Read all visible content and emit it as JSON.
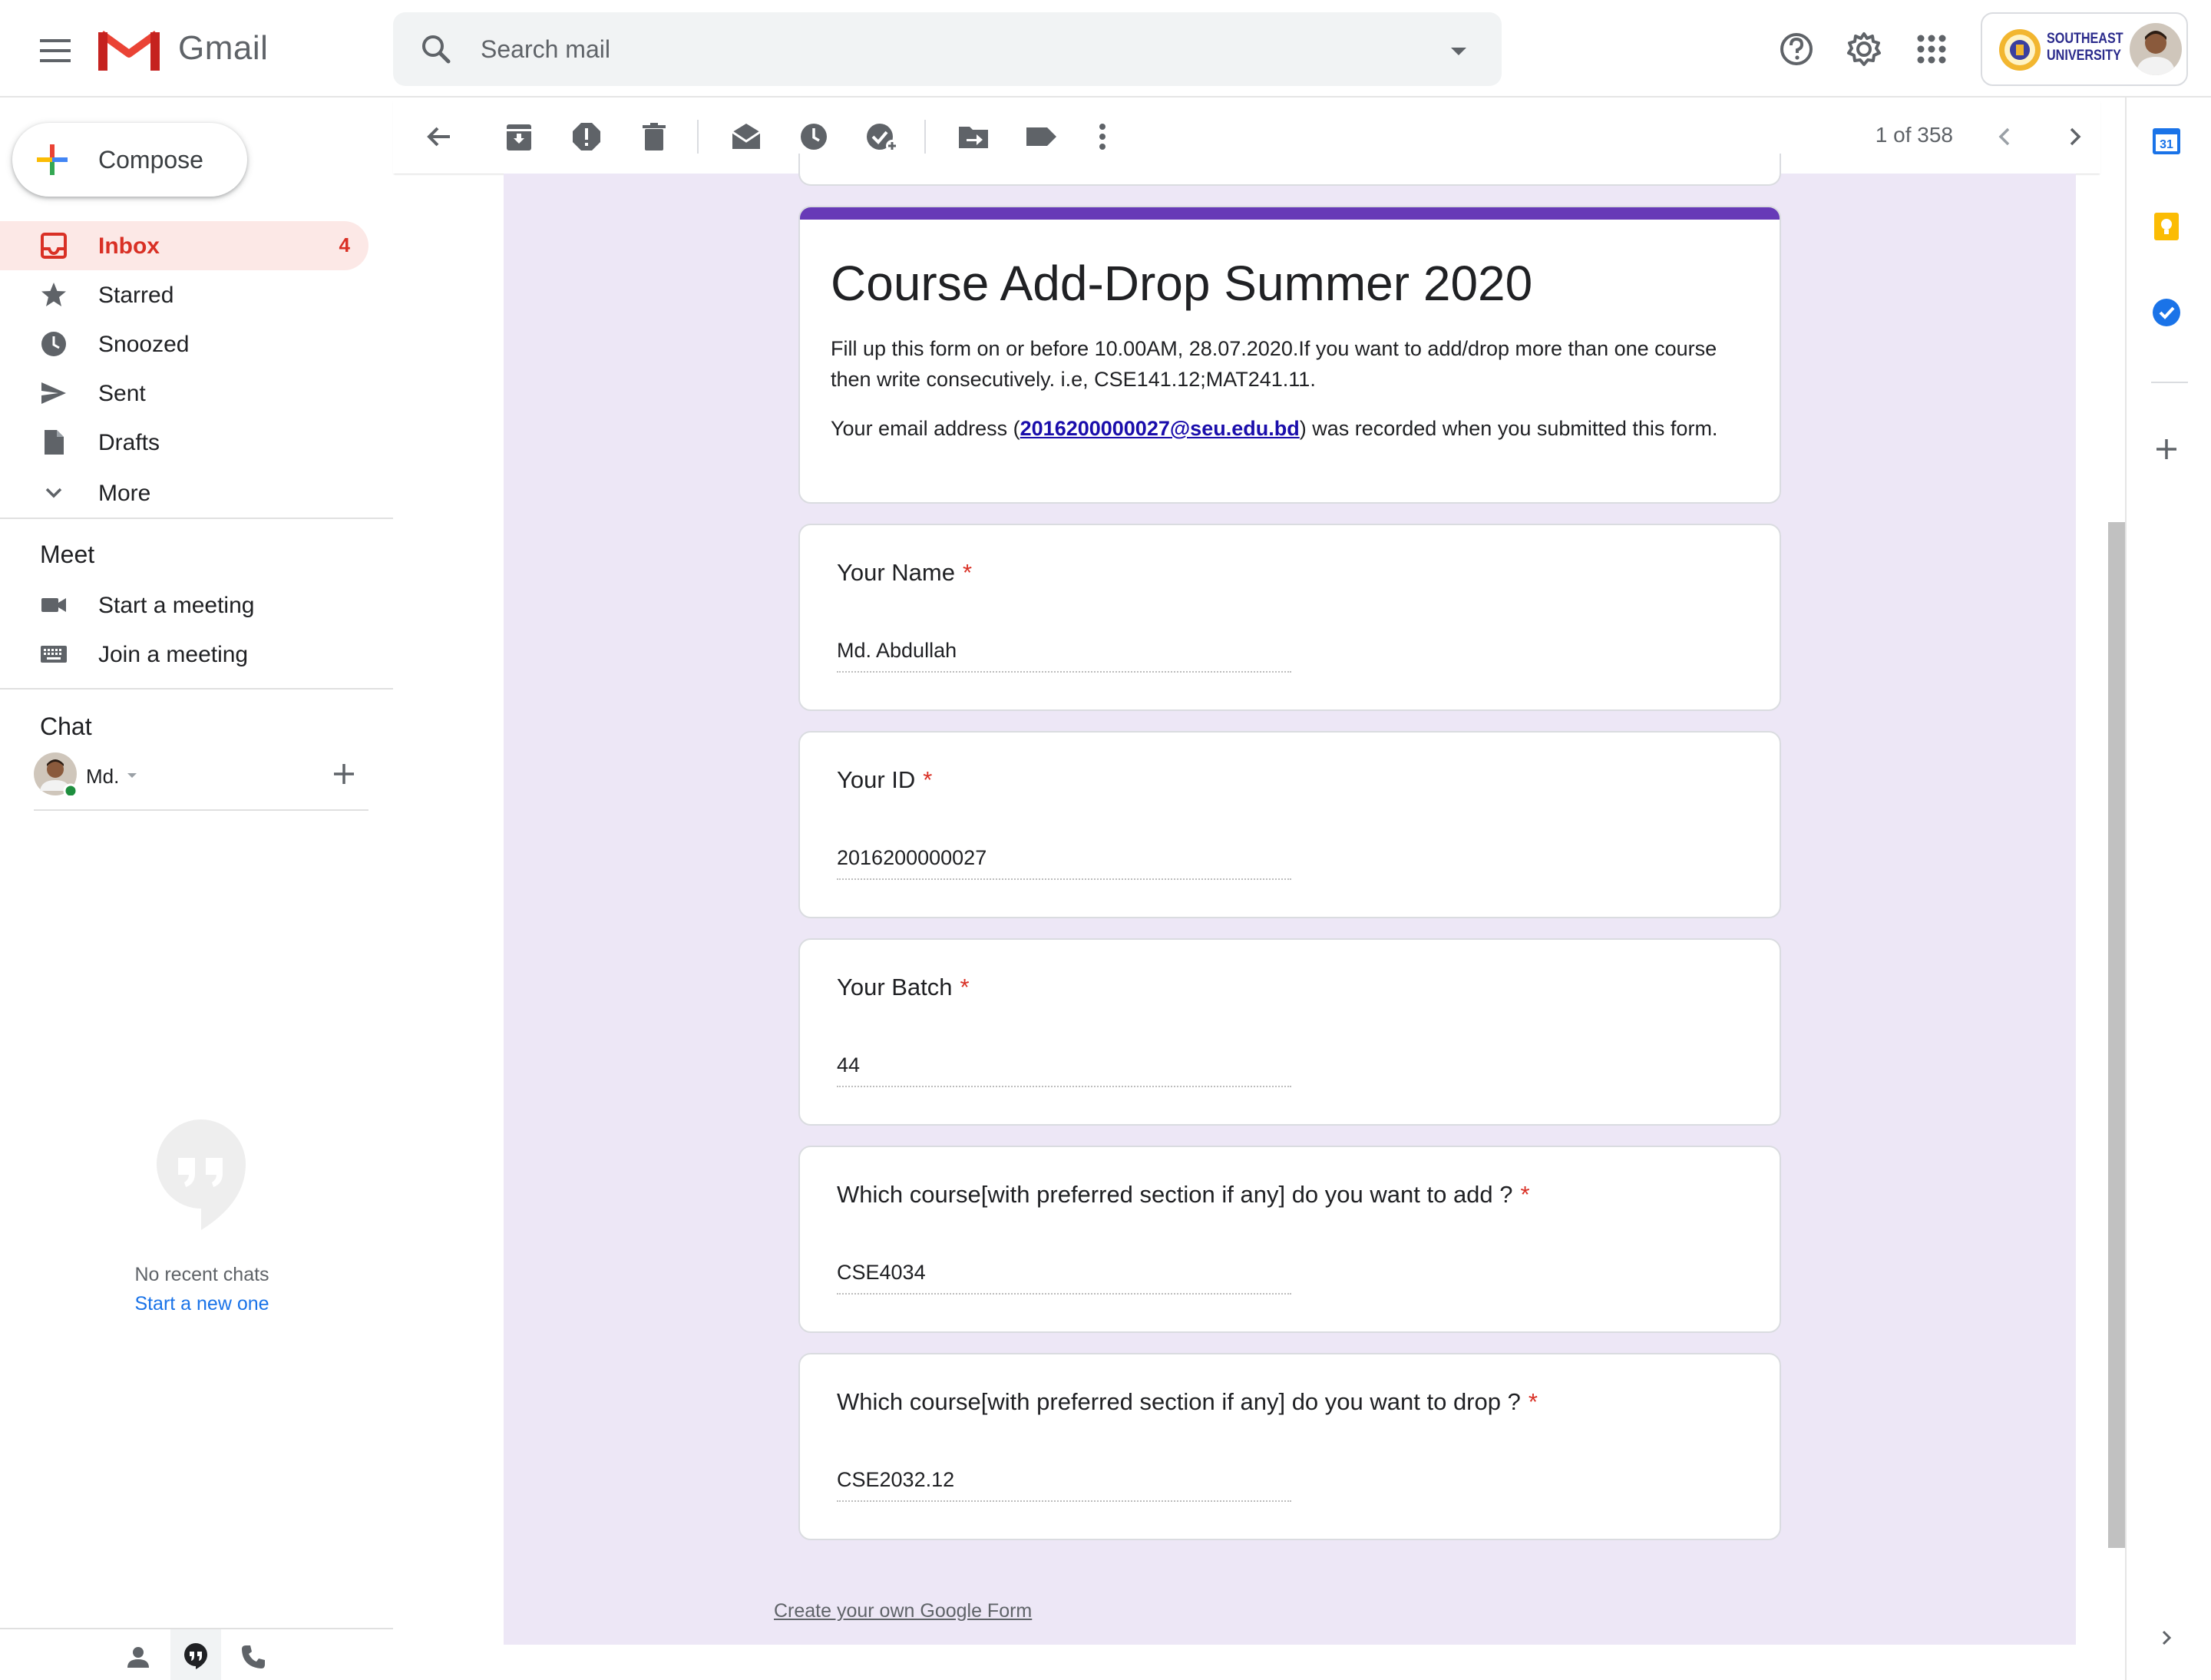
{
  "header": {
    "app_name": "Gmail",
    "search_placeholder": "Search mail",
    "university_name_line1": "SOUTHEAST",
    "university_name_line2": "UNIVERSITY"
  },
  "sidebar": {
    "compose_label": "Compose",
    "nav": [
      {
        "label": "Inbox",
        "count": "4"
      },
      {
        "label": "Starred"
      },
      {
        "label": "Snoozed"
      },
      {
        "label": "Sent"
      },
      {
        "label": "Drafts"
      },
      {
        "label": "More"
      }
    ],
    "meet": {
      "title": "Meet",
      "start": "Start a meeting",
      "join": "Join a meeting"
    },
    "chat": {
      "title": "Chat",
      "user": "Md.",
      "empty_text": "No recent chats",
      "start_link": "Start a new one"
    }
  },
  "toolbar": {
    "pager": "1 of 358"
  },
  "form": {
    "title": "Course Add-Drop Summer 2020",
    "description": "Fill up this form on or before 10.00AM, 28.07.2020.If you want to add/drop more than one course then write consecutively. i.e, CSE141.12;MAT241.11.",
    "email_prefix": "Your email address (",
    "email": "2016200000027@seu.edu.bd",
    "email_suffix": ") was recorded when you submitted this form.",
    "questions": [
      {
        "title": "Your Name",
        "required": "*",
        "answer": "Md. Abdullah"
      },
      {
        "title": "Your ID",
        "required": "*",
        "answer": "2016200000027"
      },
      {
        "title": "Your Batch",
        "required": "*",
        "answer": "44"
      },
      {
        "title": "Which course[with preferred section if any] do you want to add ?",
        "required": "*",
        "answer": "CSE4034"
      },
      {
        "title": "Which course[with preferred section if any] do you want to drop ?",
        "required": "*",
        "answer": "CSE2032.12"
      }
    ],
    "footer_link": "Create your own Google Form",
    "accent_color": "#673ab7"
  },
  "side_panel": {
    "calendar_day": "31"
  },
  "colors": {
    "inbox_highlight": "#fce8e6",
    "inbox_text": "#d93025",
    "message_background": "#ede7f6",
    "link_blue": "#1a0dab",
    "chat_link_blue": "#1a73e8"
  }
}
